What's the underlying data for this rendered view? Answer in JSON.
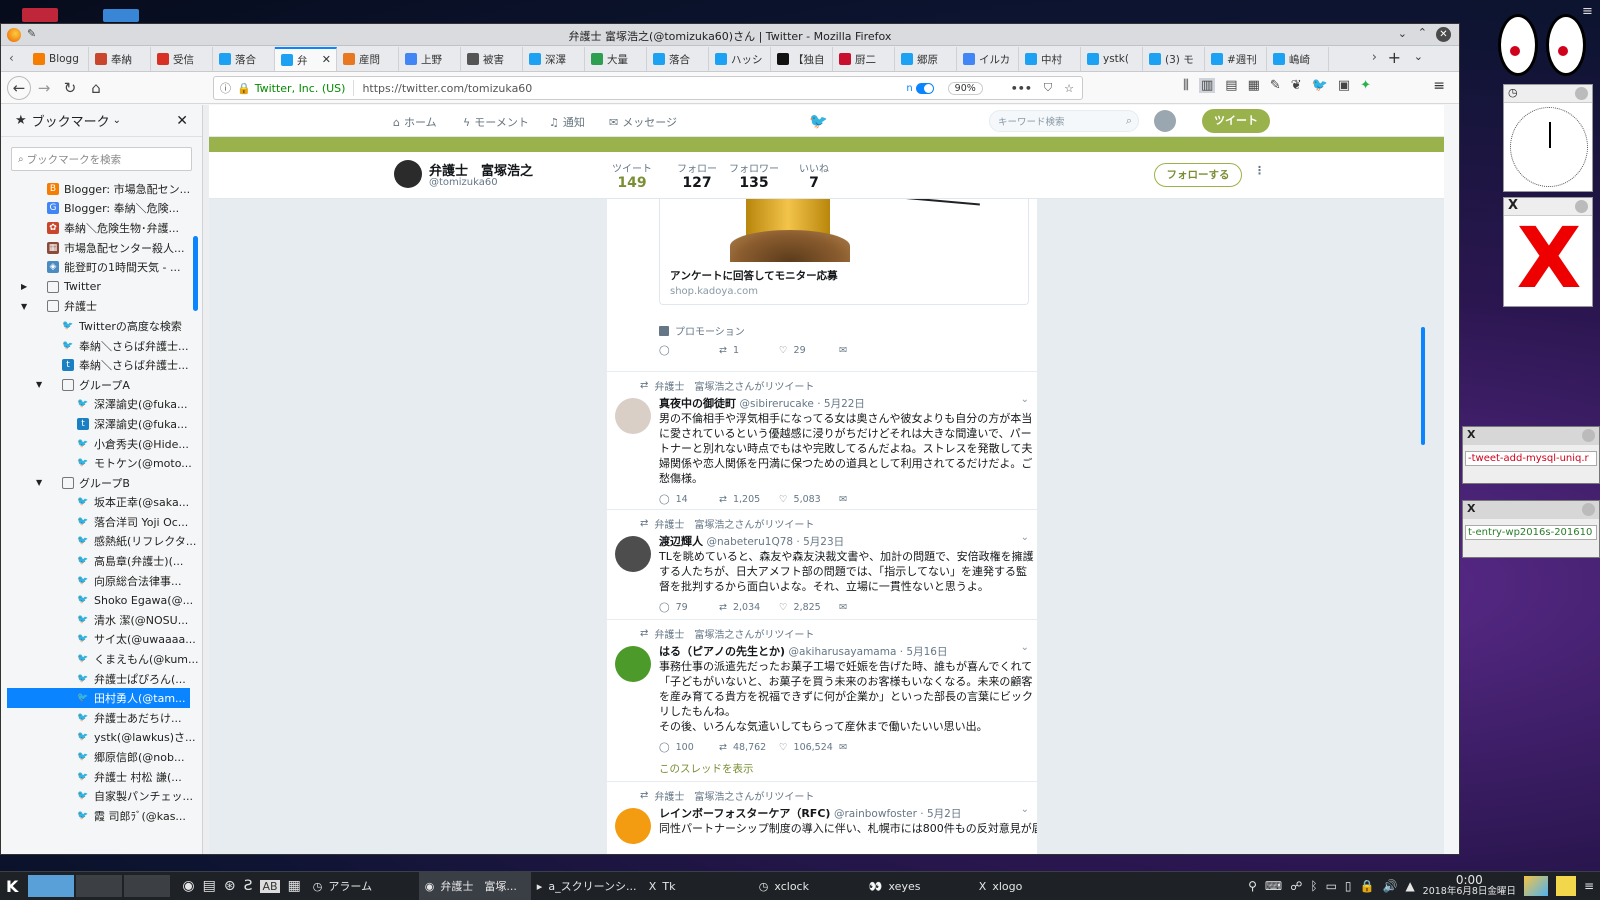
{
  "window": {
    "title": "弁護士 富塚浩之(@tomizuka60)さん | Twitter - Mozilla Firefox"
  },
  "tabs": [
    {
      "label": "Blogg",
      "color": "#f57d00"
    },
    {
      "label": "奉納",
      "color": "#c9462c"
    },
    {
      "label": "受信",
      "color": "#d93025"
    },
    {
      "label": "落合",
      "color": "#1da1f2"
    },
    {
      "label": "弁",
      "color": "#1da1f2",
      "active": true
    },
    {
      "label": "産問",
      "color": "#e87722"
    },
    {
      "label": "上野",
      "color": "#4285f4"
    },
    {
      "label": "被害",
      "color": "#555"
    },
    {
      "label": "深澤",
      "color": "#1da1f2"
    },
    {
      "label": "大量",
      "color": "#2e9e4f"
    },
    {
      "label": "落合",
      "color": "#1da1f2"
    },
    {
      "label": "ハッシ",
      "color": "#1da1f2"
    },
    {
      "label": "【独自",
      "color": "#111"
    },
    {
      "label": "厨二",
      "color": "#c8102e"
    },
    {
      "label": "郷原",
      "color": "#1da1f2"
    },
    {
      "label": "イルカ",
      "color": "#4285f4"
    },
    {
      "label": "中村",
      "color": "#1da1f2"
    },
    {
      "label": "ystk(",
      "color": "#1da1f2"
    },
    {
      "label": "(3) モ",
      "color": "#1da1f2"
    },
    {
      "label": "#週刊",
      "color": "#1da1f2"
    },
    {
      "label": "嶋崎",
      "color": "#1da1f2"
    }
  ],
  "urlbar": {
    "identity": "Twitter, Inc. (US)",
    "url": "https://twitter.com/tomizuka60",
    "zoom": "90%",
    "toggle": "n"
  },
  "sidebar": {
    "title": "ブックマーク",
    "search_placeholder": "ブックマークを検索",
    "items": [
      {
        "label": "Blogger: 市場急配セン...",
        "indent": 0,
        "type": "blogger"
      },
      {
        "label": "Blogger: 奉納＼危険...",
        "indent": 0,
        "type": "google"
      },
      {
        "label": "奉納＼危険生物･弁護...",
        "indent": 0,
        "type": "fire"
      },
      {
        "label": "市場急配センター殺人...",
        "indent": 0,
        "type": "page"
      },
      {
        "label": "能登町の1時間天気 - ...",
        "indent": 0,
        "type": "cube"
      },
      {
        "label": "Twitter",
        "indent": 0,
        "type": "folder-closed"
      },
      {
        "label": "弁護士",
        "indent": 0,
        "type": "folder-open"
      },
      {
        "label": "Twitterの高度な検索",
        "indent": 1,
        "type": "tw"
      },
      {
        "label": "奉納＼さらば弁護士...",
        "indent": 1,
        "type": "tw"
      },
      {
        "label": "奉納＼さらば弁護士...",
        "indent": 1,
        "type": "tw2"
      },
      {
        "label": "グループA",
        "indent": 1,
        "type": "folder-open"
      },
      {
        "label": "深澤諭史(@fuka...",
        "indent": 2,
        "type": "tw"
      },
      {
        "label": "深澤諭史(@fuka...",
        "indent": 2,
        "type": "tw2"
      },
      {
        "label": "小倉秀夫(@Hide...",
        "indent": 2,
        "type": "tw"
      },
      {
        "label": "モトケン(@moto...",
        "indent": 2,
        "type": "tw"
      },
      {
        "label": "グループB",
        "indent": 1,
        "type": "folder-open"
      },
      {
        "label": "坂本正幸(@saka...",
        "indent": 2,
        "type": "tw"
      },
      {
        "label": "落合洋司 Yoji Oc...",
        "indent": 2,
        "type": "tw"
      },
      {
        "label": "感熱紙(リフレクタ...",
        "indent": 2,
        "type": "tw"
      },
      {
        "label": "高島章(弁護士)(...",
        "indent": 2,
        "type": "tw"
      },
      {
        "label": "向原総合法律事...",
        "indent": 2,
        "type": "tw"
      },
      {
        "label": "Shoko Egawa(@...",
        "indent": 2,
        "type": "tw"
      },
      {
        "label": "清水 潔(@NOSU...",
        "indent": 2,
        "type": "tw"
      },
      {
        "label": "サイ太(@uwaaaa...",
        "indent": 2,
        "type": "tw"
      },
      {
        "label": "くまえもん(@kum...",
        "indent": 2,
        "type": "tw"
      },
      {
        "label": "弁護士ぱぴろん(...",
        "indent": 2,
        "type": "tw"
      },
      {
        "label": "田村勇人(@tam...",
        "indent": 2,
        "type": "tw",
        "selected": true
      },
      {
        "label": "弁護士あだちけ...",
        "indent": 2,
        "type": "tw"
      },
      {
        "label": "ystk(@lawkus)さ...",
        "indent": 2,
        "type": "tw"
      },
      {
        "label": "郷原信郎(@nob...",
        "indent": 2,
        "type": "tw"
      },
      {
        "label": "弁護士 村松 謙(...",
        "indent": 2,
        "type": "tw"
      },
      {
        "label": "自家製パンチェッ...",
        "indent": 2,
        "type": "tw"
      },
      {
        "label": "霞 司郎ﾗﾞ(@kas...",
        "indent": 2,
        "type": "tw"
      }
    ]
  },
  "twitter_nav": {
    "home": "ホーム",
    "moments": "モーメント",
    "notifications": "通知",
    "messages": "メッセージ",
    "search_placeholder": "キーワード検索",
    "tweet_button": "ツイート"
  },
  "profile": {
    "name": "弁護士　富塚浩之",
    "handle": "@tomizuka60",
    "follow_button": "フォローする",
    "stats": [
      {
        "label": "ツイート",
        "value": "149"
      },
      {
        "label": "フォロー",
        "value": "127"
      },
      {
        "label": "フォロワー",
        "value": "135"
      },
      {
        "label": "いいね",
        "value": "7"
      }
    ]
  },
  "promo": {
    "card_title": "アンケートに回答してモニター応募",
    "card_domain": "shop.kadoya.com",
    "label": "プロモーション",
    "retweets": "1",
    "likes": "29"
  },
  "tweets": [
    {
      "retweeted_by": "弁護士　富塚浩之さんがリツイート",
      "name": "真夜中の御徒町",
      "handle": "@sibirerucake",
      "date": "5月22日",
      "lines": [
        "男の不倫相手や浮気相手になってる女は奥さんや彼女よりも自分の方が本当",
        "に愛されているという優越感に浸りがちだけどそれは大きな間違いで、パー",
        "トナーと別れない時点でもはや完敗してるんだよね。ストレスを発散して夫",
        "婦関係や恋人関係を円満に保つための道具として利用されてるだけだよ。ご",
        "愁傷様。"
      ],
      "replies": "14",
      "retweets": "1,205",
      "likes": "5,083"
    },
    {
      "retweeted_by": "弁護士　富塚浩之さんがリツイート",
      "name": "渡辺輝人",
      "handle": "@nabeteru1Q78",
      "date": "5月23日",
      "lines": [
        "TLを眺めていると、森友や森友決裁文書や、加計の問題で、安倍政権を擁護",
        "する人たちが、日大アメフト部の問題では、「指示してない」を連発する監",
        "督を批判するから面白いよな。それ、立場に一貫性ないと思うよ。"
      ],
      "replies": "79",
      "retweets": "2,034",
      "likes": "2,825"
    },
    {
      "retweeted_by": "弁護士　富塚浩之さんがリツイート",
      "name": "はる（ピアノの先生とか)",
      "handle": "@akiharusayamama",
      "date": "5月16日",
      "lines": [
        "事務仕事の派遣先だったお菓子工場で妊娠を告げた時、誰もが喜んでくれて",
        "「子どもがいないと、お菓子を買う未来のお客様もいなくなる。未来の顧客",
        "を産み育てる貴方を祝福できずに何が企業か」といった部長の言葉にビック",
        "リしたもんね。",
        "その後、いろんな気遣いしてもらって産休まで働いたいい思い出。"
      ],
      "replies": "100",
      "retweets": "48,762",
      "likes": "106,524",
      "thread": "このスレッドを表示"
    },
    {
      "retweeted_by": "弁護士　富塚浩之さんがリツイート",
      "name": "レインボーフォスターケア（RFC)",
      "handle": "@rainbowfoster",
      "date": "5月2日",
      "lines": [
        "同性パートナーシップ制度の導入に伴い、札幌市には800件もの反対意見が届"
      ],
      "replies": "",
      "retweets": "",
      "likes": ""
    }
  ],
  "right_windows": {
    "url1": "-tweet-add-mysql-uniq.r",
    "url2": "t-entry-wp2016s-201610"
  },
  "taskbar": {
    "items": [
      "アラーム",
      "弁護士　富塚...",
      "a_スクリーンシ...",
      "Tk",
      "xclock",
      "xeyes",
      "xlogo"
    ],
    "clock_time": "0:00",
    "clock_date": "2018年6月8日金曜日"
  }
}
